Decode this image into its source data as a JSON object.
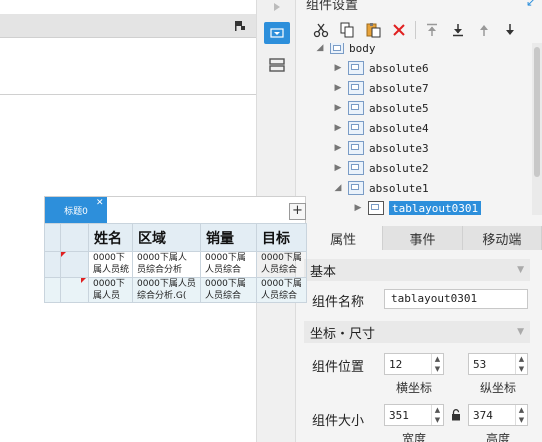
{
  "panel": {
    "title": "组件设置",
    "toolbar": {
      "cut": "scissors-icon",
      "copy": "copy-icon",
      "paste": "paste-icon",
      "delete": "delete-icon",
      "move_top": "move-top-icon",
      "move_bottom": "move-bottom-icon",
      "move_up": "move-up-icon",
      "move_down": "move-down-icon"
    },
    "tree": {
      "root": "body",
      "items": [
        "absolute6",
        "absolute7",
        "absolute5",
        "absolute4",
        "absolute3",
        "absolute2",
        "absolute1"
      ],
      "selected_child": "tablayout0301"
    },
    "tabs": [
      "属性",
      "事件",
      "移动端"
    ],
    "sections": {
      "basic": "基本",
      "coords": "坐标・尺寸"
    },
    "props": {
      "name_label": "组件名称",
      "name_value": "tablayout0301",
      "position_label": "组件位置",
      "x_value": "12",
      "y_value": "53",
      "x_caption": "横坐标",
      "y_caption": "纵坐标",
      "size_label": "组件大小",
      "width_value": "351",
      "height_value": "374",
      "width_caption": "宽度",
      "height_caption": "高度"
    }
  },
  "sheet": {
    "tab_label": "标题0",
    "add_label": "+",
    "headers": [
      "姓名",
      "区域",
      "销量",
      "目标"
    ],
    "rows": [
      [
        "0000下\n属人员统",
        "0000下属人\n员综合分析",
        "0000下属\n人员综合",
        "0000下属\n人员综合"
      ],
      [
        "0000下\n属人员",
        "0000下属人员\n综合分析.G(",
        "0000下属\n人员综合",
        "0000下属\n人员综合"
      ]
    ]
  },
  "colors": {
    "accent": "#2d8fdb",
    "header_bg": "#e3edf4",
    "row_alt_bg": "#e9f3f7"
  }
}
